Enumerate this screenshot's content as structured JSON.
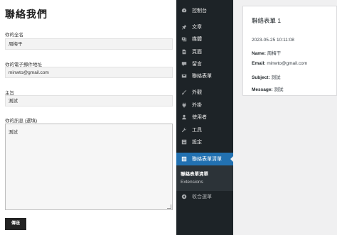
{
  "form": {
    "title": "聯絡我們",
    "name_label": "你的全名",
    "name_value": "周梅干",
    "email_label": "你的電子郵件地址",
    "email_value": "minwto@gmail.com",
    "subject_label": "主旨",
    "subject_value": "測試",
    "message_label": "你的訊息 (選填)",
    "message_value": "測試",
    "submit_label": "傳送"
  },
  "admin_menu": {
    "items": [
      {
        "label": "控制台",
        "icon": "dashboard-icon"
      },
      {
        "label": "文章",
        "icon": "pin-icon"
      },
      {
        "label": "媒體",
        "icon": "media-icon"
      },
      {
        "label": "頁面",
        "icon": "page-icon"
      },
      {
        "label": "留言",
        "icon": "comment-icon"
      },
      {
        "label": "聯絡表單",
        "icon": "mail-icon"
      },
      {
        "label": "外觀",
        "icon": "brush-icon"
      },
      {
        "label": "外掛",
        "icon": "plugin-icon"
      },
      {
        "label": "使用者",
        "icon": "user-icon"
      },
      {
        "label": "工具",
        "icon": "wrench-icon"
      },
      {
        "label": "設定",
        "icon": "settings-icon"
      },
      {
        "label": "聯絡表單清單",
        "icon": "list-icon"
      }
    ],
    "submenu": [
      "聯絡表單清單",
      "Extensions"
    ],
    "collapse_label": "收合選單"
  },
  "entry": {
    "title": "聯絡表單 1",
    "date": "2023-05-25 10:11:08",
    "name_key": "Name:",
    "name_val": "周梅干",
    "email_key": "Email:",
    "email_val": "minwto@gmail.com",
    "subject_key": "Subject:",
    "subject_val": "測試",
    "message_key": "Message:",
    "message_val": "測試"
  },
  "colors": {
    "sidebar_bg": "#1d2327",
    "active_item": "#2271b1",
    "submit_button": "#232323"
  }
}
